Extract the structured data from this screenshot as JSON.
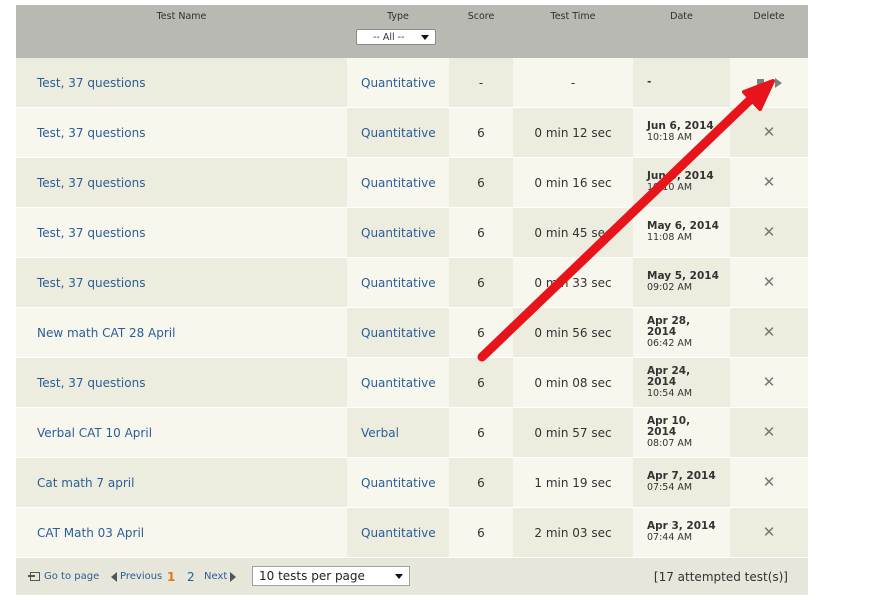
{
  "header": {
    "test_name": "Test Name",
    "type": "Type",
    "type_filter": "-- All --",
    "score": "Score",
    "test_time": "Test Time",
    "date": "Date",
    "delete": "Delete"
  },
  "rows": [
    {
      "name": "Test, 37 questions",
      "type": "Quantitative",
      "score": "-",
      "time": "-",
      "date_line1": "-",
      "date_line2": "",
      "action": "play"
    },
    {
      "name": "Test, 37 questions",
      "type": "Quantitative",
      "score": "6",
      "time": "0 min 12 sec",
      "date_line1": "Jun 6, 2014",
      "date_line2": "10:18 AM",
      "action": "delete"
    },
    {
      "name": "Test, 37 questions",
      "type": "Quantitative",
      "score": "6",
      "time": "0 min 16 sec",
      "date_line1": "Jun 6, 2014",
      "date_line2": "10:10 AM",
      "action": "delete"
    },
    {
      "name": "Test, 37 questions",
      "type": "Quantitative",
      "score": "6",
      "time": "0 min 45 sec",
      "date_line1": "May 6, 2014",
      "date_line2": "11:08 AM",
      "action": "delete"
    },
    {
      "name": "Test, 37 questions",
      "type": "Quantitative",
      "score": "6",
      "time": "0 min 33 sec",
      "date_line1": "May 5, 2014",
      "date_line2": "09:02 AM",
      "action": "delete"
    },
    {
      "name": "New math CAT 28 April",
      "type": "Quantitative",
      "score": "6",
      "time": "0 min 56 sec",
      "date_line1": "Apr 28,",
      "date_line1b": "2014",
      "date_line2": "06:42 AM",
      "action": "delete"
    },
    {
      "name": "Test, 37 questions",
      "type": "Quantitative",
      "score": "6",
      "time": "0 min 08 sec",
      "date_line1": "Apr 24,",
      "date_line1b": "2014",
      "date_line2": "10:54 AM",
      "action": "delete"
    },
    {
      "name": "Verbal CAT 10 April",
      "type": "Verbal",
      "score": "6",
      "time": "0 min 57 sec",
      "date_line1": "Apr 10,",
      "date_line1b": "2014",
      "date_line2": "08:07 AM",
      "action": "delete"
    },
    {
      "name": "Cat math 7 april",
      "type": "Quantitative",
      "score": "6",
      "time": "1 min 19 sec",
      "date_line1": "Apr 7, 2014",
      "date_line2": "07:54 AM",
      "action": "delete"
    },
    {
      "name": "CAT Math 03 April",
      "type": "Quantitative",
      "score": "6",
      "time": "2 min 03 sec",
      "date_line1": "Apr 3, 2014",
      "date_line2": "07:44 AM",
      "action": "delete"
    }
  ],
  "footer": {
    "goto_page": "Go to page",
    "previous": "Previous",
    "pages": [
      "1",
      "2"
    ],
    "current_page": "1",
    "next": "Next",
    "per_page": "10 tests per page",
    "count": "[17 attempted test(s)]"
  },
  "colors": {
    "header_bg": "#b9b9b3",
    "row_light": "#f7f7ed",
    "row_dark": "#ededdf",
    "link": "#2b5d99",
    "arrow": "#e8141c",
    "current_page": "#e07b1a"
  },
  "icons": {
    "stop": "stop-icon",
    "play": "play-icon",
    "delete": "x-icon",
    "goto": "goto-icon"
  }
}
